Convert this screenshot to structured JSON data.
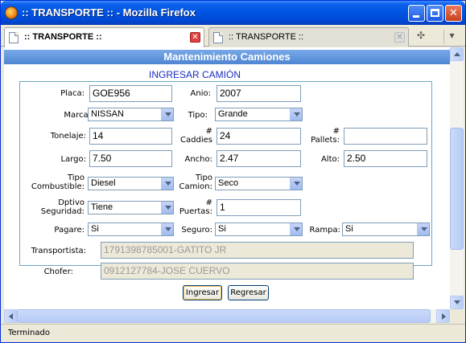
{
  "window": {
    "title": ":: TRANSPORTE :: - Mozilla Firefox"
  },
  "tabs": [
    {
      "label": ":: TRANSPORTE ::",
      "active": true
    },
    {
      "label": ":: TRANSPORTE ::",
      "active": false
    }
  ],
  "page": {
    "header": "Mantenimiento Camiones",
    "form_title": "INGRESAR CAMIÓN"
  },
  "form": {
    "placa": {
      "label": "Placa:",
      "value": "GOE956"
    },
    "anio": {
      "label": "Anio:",
      "value": "2007"
    },
    "marca": {
      "label": "Marca:",
      "value": "NISSAN"
    },
    "tipo": {
      "label": "Tipo:",
      "value": "Grande"
    },
    "tonelaje": {
      "label": "Tonelaje:",
      "value": "14"
    },
    "caddies": {
      "label_line1": "#",
      "label_line2": "Caddies",
      "value": "24"
    },
    "pallets": {
      "label_line1": "#",
      "label_line2": "Pallets:",
      "value": ""
    },
    "largo": {
      "label": "Largo:",
      "value": "7.50"
    },
    "ancho": {
      "label": "Ancho:",
      "value": "2.47"
    },
    "alto": {
      "label": "Alto:",
      "value": "2.50"
    },
    "tipo_combustible": {
      "label_line1": "Tipo",
      "label_line2": "Combustible:",
      "value": "Diesel"
    },
    "tipo_camion": {
      "label_line1": "Tipo",
      "label_line2": "Camion:",
      "value": "Seco"
    },
    "dispositivo_seguridad": {
      "label_line1": "Dptivo",
      "label_line2": "Seguridad:",
      "value": "Tiene"
    },
    "puertas": {
      "label_line1": "#",
      "label_line2": "Puertas:",
      "value": "1"
    },
    "pagare": {
      "label": "Pagare:",
      "value": "Si"
    },
    "seguro": {
      "label": "Seguro:",
      "value": "Si"
    },
    "rampa": {
      "label": "Rampa:",
      "value": "Si"
    },
    "transportista": {
      "label": "Transportista:",
      "value": "1791398785001-GATITO JR"
    },
    "chofer": {
      "label": "Chofer:",
      "value": "0912127784-JOSE CUERVO"
    }
  },
  "buttons": {
    "ingresar": "Ingresar",
    "regresar": "Regresar"
  },
  "statusbar": {
    "text": "Terminado"
  },
  "icons": {
    "app": "firefox-icon",
    "tab": "page-icon"
  }
}
